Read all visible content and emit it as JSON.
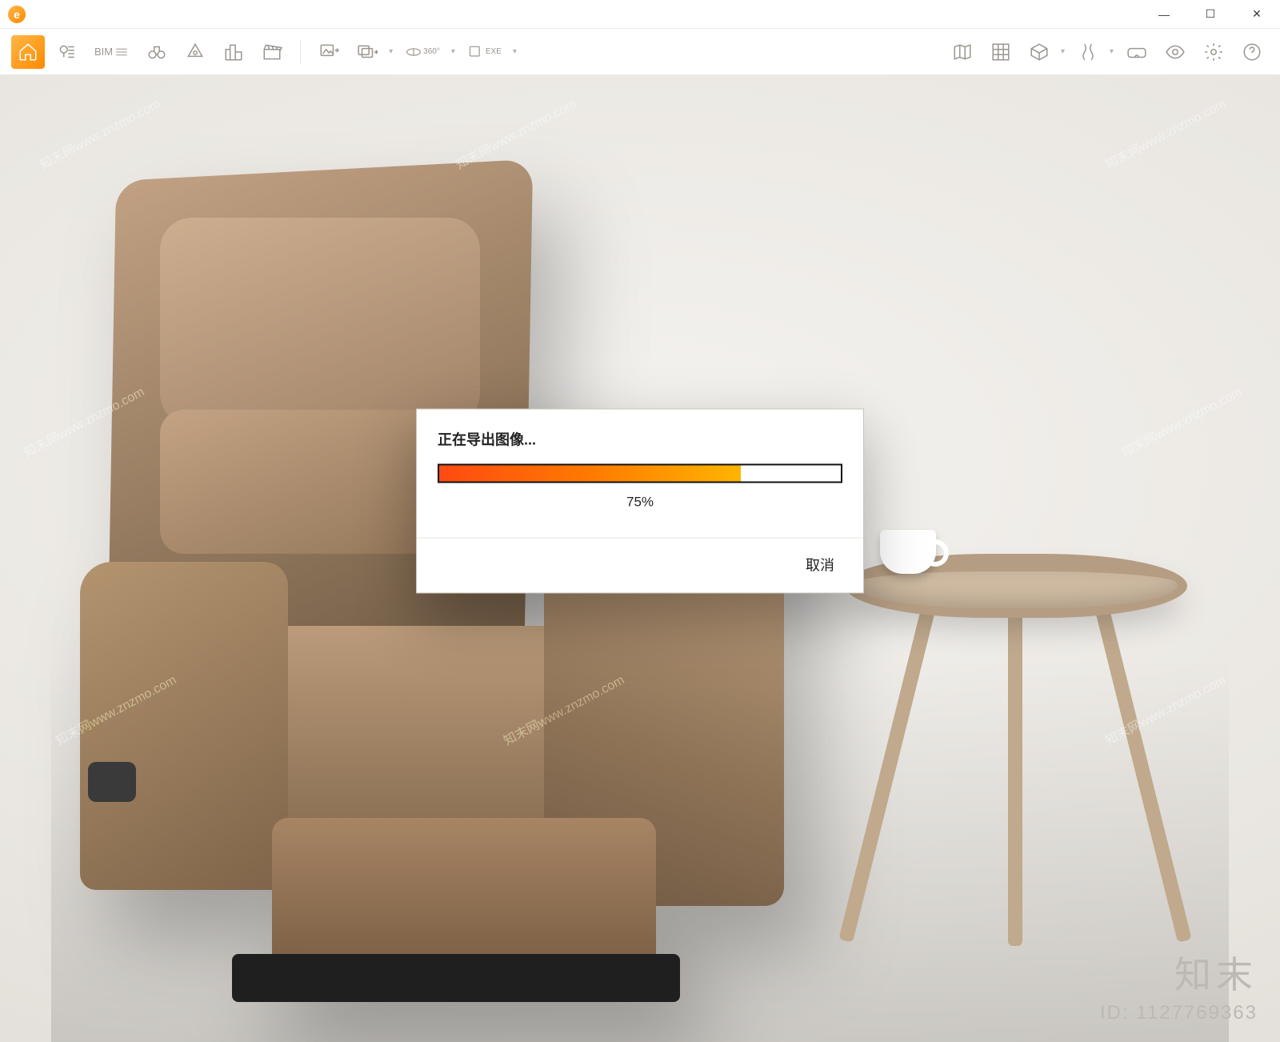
{
  "window": {
    "logo_letter": "e",
    "minimize_glyph": "—",
    "maximize_glyph": "☐",
    "close_glyph": "✕"
  },
  "toolbar": {
    "left": [
      {
        "name": "home",
        "icon": "home",
        "active": true
      },
      {
        "name": "location",
        "icon": "pin",
        "active": false
      },
      {
        "name": "bim",
        "icon": "text",
        "label": "BIM",
        "active": false
      },
      {
        "name": "binoculars",
        "icon": "binoc",
        "active": false
      },
      {
        "name": "marker",
        "icon": "marker",
        "active": false
      },
      {
        "name": "buildings",
        "icon": "city",
        "active": false
      },
      {
        "name": "clapper",
        "icon": "clap",
        "active": false
      }
    ],
    "export": [
      {
        "name": "export-image",
        "icon": "imgexp"
      },
      {
        "name": "export-set",
        "icon": "imgset",
        "dropdown": true
      },
      {
        "name": "export-360",
        "icon": "pano",
        "label": "360°",
        "dropdown": true
      },
      {
        "name": "export-exe",
        "icon": "exe",
        "label": "EXE",
        "dropdown": true
      }
    ],
    "right": [
      {
        "name": "map",
        "icon": "mapfold"
      },
      {
        "name": "grid",
        "icon": "grid"
      },
      {
        "name": "cube",
        "icon": "cube",
        "dropdown": true
      },
      {
        "name": "walk",
        "icon": "walk",
        "dropdown": true
      },
      {
        "name": "vr",
        "icon": "vr"
      },
      {
        "name": "eye",
        "icon": "eye"
      },
      {
        "name": "settings",
        "icon": "gear"
      },
      {
        "name": "help",
        "icon": "help"
      }
    ],
    "orange_arrow_glyph": "⌃"
  },
  "modal": {
    "title": "正在导出图像...",
    "percent_value": 75,
    "percent_text": "75%",
    "cancel_label": "取消"
  },
  "overlay": {
    "brand_text": "知末",
    "id_text": "ID: 1127769363",
    "watermark_text": "知末网www.znzmo.com"
  },
  "colors": {
    "accent_start": "#ff4a12",
    "accent_end": "#ffb400",
    "toolbar_icon": "#9b968f"
  }
}
